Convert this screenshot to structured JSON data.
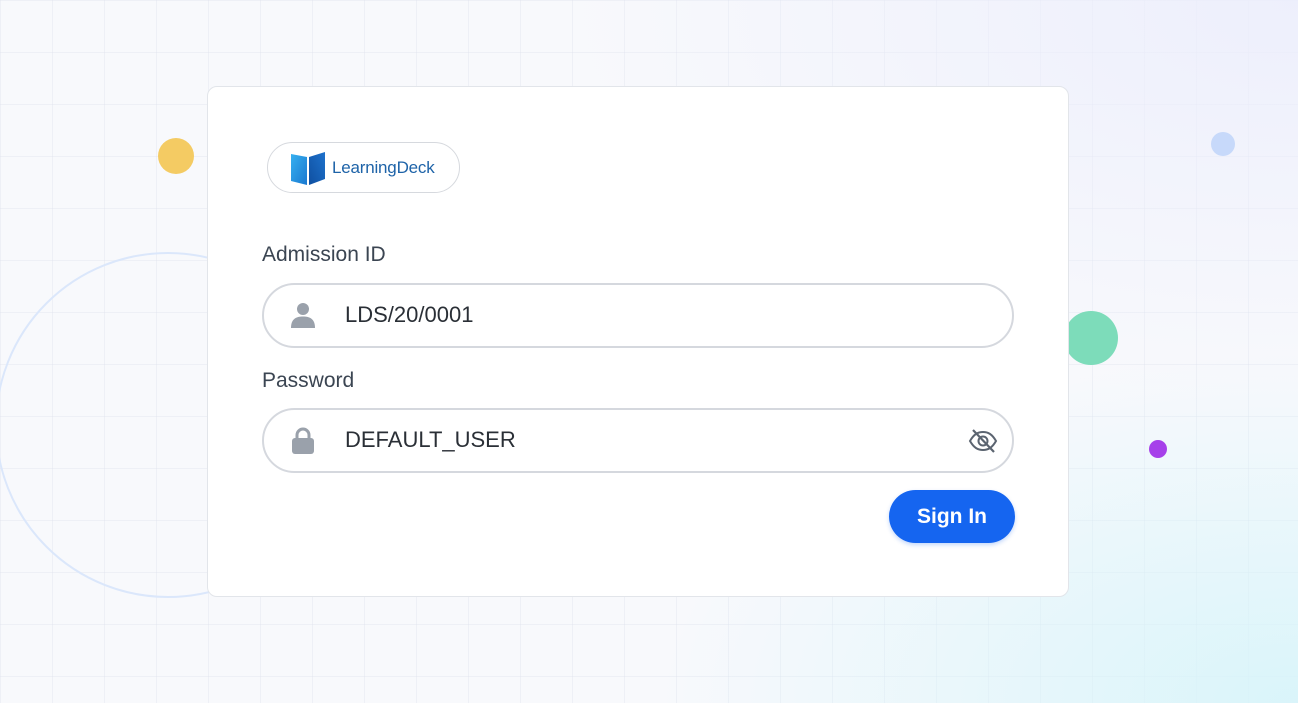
{
  "logo": {
    "text": "LearningDeck",
    "icon": "open-book-icon",
    "color": "#1e63a8"
  },
  "form": {
    "admission_label": "Admission ID",
    "admission_value": "LDS/20/0001",
    "admission_icon": "user-icon",
    "password_label": "Password",
    "password_value": "DEFAULT_USER",
    "password_icon": "lock-icon",
    "visibility_icon": "eye-off-icon",
    "signin_label": "Sign In"
  },
  "colors": {
    "accent": "#1565f0",
    "dot_yellow": "#f4cb63",
    "dot_green": "#7ddcba",
    "dot_purple": "#a640ea",
    "dot_blue": "#c7d9fa"
  }
}
